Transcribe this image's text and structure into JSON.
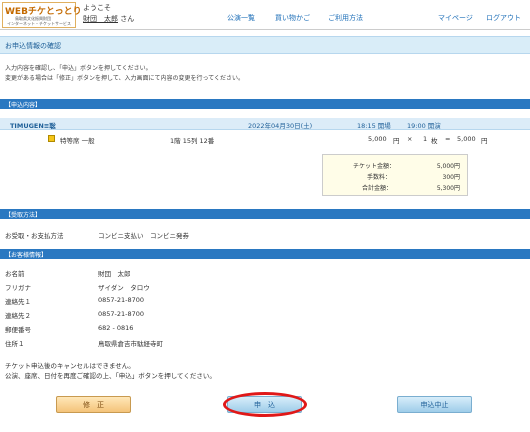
{
  "header": {
    "logo_line1": "WEBチケとっとり",
    "logo_line2": "鳥取県文化振興財団",
    "logo_line3": "インターネット・チケットサービス",
    "welcome": "ようこそ",
    "user_name": "財団　太郎",
    "user_suffix": "さん",
    "nav": [
      {
        "label": "公演一覧"
      },
      {
        "label": "買い物かご"
      },
      {
        "label": "ご利用方法"
      },
      {
        "label": "マイページ"
      },
      {
        "label": "ログアウト"
      }
    ]
  },
  "page_title": "お申込情報の確認",
  "instructions": [
    "入力内容を確認し、「申込」ボタンを押してください。",
    "変更がある場合は「修正」ボタンを押して、入力画面にて内容の変更を行ってください。"
  ],
  "section1": {
    "title": "【申込内容】",
    "event": {
      "name": "TIMUGEN≡聡",
      "date": "2022年04月30日(土)",
      "open": "18:15 開場",
      "start": "19:00 開演"
    },
    "item": {
      "seat_type": "特等席 一般",
      "seat": "1階 15列 12番",
      "price": "5,000",
      "yen": "円",
      "times": "×",
      "qty": "1",
      "unit": "枚",
      "eq": "=",
      "subtotal": "5,000",
      "yen2": "円"
    },
    "fees": {
      "ticket_label": "チケット金額：",
      "ticket_value": "5,000円",
      "fee_label": "手数料：",
      "fee_value": "300円",
      "total_label": "合計金額：",
      "total_value": "5,300円"
    }
  },
  "section2": {
    "title": "【受取方法】",
    "label": "お受取・お支払方法",
    "value": "コンビニ支払い　コンビニ発券"
  },
  "section3": {
    "title": "【お客様情報】",
    "fields": [
      {
        "label": "お名前",
        "value": "財団　太郎"
      },
      {
        "label": "フリガナ",
        "value": "ザイダン　タロウ"
      },
      {
        "label": "連絡先１",
        "value": "0857-21-8700"
      },
      {
        "label": "連絡先２",
        "value": "0857-21-8700"
      },
      {
        "label": "郵便番号",
        "value": "682 - 0816"
      },
      {
        "label": "住所１",
        "value": "鳥取県倉吉市駄経寺町"
      }
    ]
  },
  "notes": [
    "チケット申込後のキャンセルはできません。",
    "公演、座席、日付を再度ご確認の上、「申込」ボタンを押してください。"
  ],
  "buttons": {
    "fix": "修　正",
    "apply": "申　込",
    "cancel": "申込中止"
  }
}
